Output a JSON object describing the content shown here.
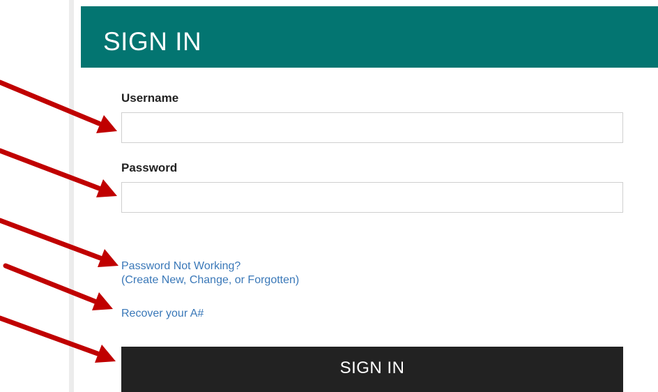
{
  "form": {
    "title": "SIGN IN",
    "username_label": "Username",
    "username_value": "",
    "password_label": "Password",
    "password_value": "",
    "password_help_line1": "Password Not Working?",
    "password_help_line2": "(Create New, Change, or Forgotten)",
    "recover_link": "Recover your A#",
    "signin_button": "SIGN IN"
  },
  "annotations": {
    "arrow_color": "#c00000"
  },
  "colors": {
    "header_bg": "#037571",
    "button_bg": "#222222",
    "link": "#3a78b8"
  }
}
